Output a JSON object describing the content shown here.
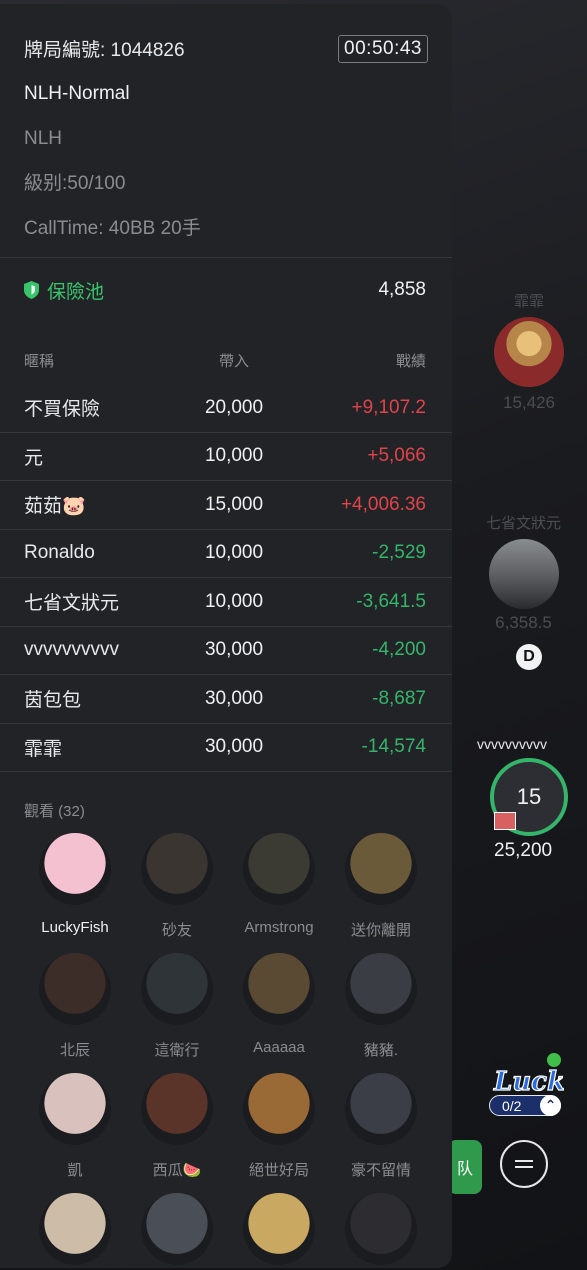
{
  "panel": {
    "hand_id": "牌局編號: 1044826",
    "timer": "00:50:43",
    "game_name": "NLH-Normal",
    "game_type": "NLH",
    "blinds": "級别:50/100",
    "calltime": "CallTime: 40BB 20手",
    "insurance_label": "保險池",
    "insurance_value": "4,858"
  },
  "table": {
    "headers": [
      "暱稱",
      "帶入",
      "戰績"
    ],
    "rows": [
      {
        "name": "不買保險",
        "buyin": "20,000",
        "result": "+9,107.2",
        "sign": "pos"
      },
      {
        "name": "元",
        "buyin": "10,000",
        "result": "+5,066",
        "sign": "pos"
      },
      {
        "name": "茹茹🐷",
        "buyin": "15,000",
        "result": "+4,006.36",
        "sign": "pos"
      },
      {
        "name": "Ronaldo",
        "buyin": "10,000",
        "result": "-2,529",
        "sign": "neg"
      },
      {
        "name": "七省文狀元",
        "buyin": "10,000",
        "result": "-3,641.5",
        "sign": "neg"
      },
      {
        "name": "vvvvvvvvvv",
        "buyin": "30,000",
        "result": "-4,200",
        "sign": "neg"
      },
      {
        "name": "茵包包",
        "buyin": "30,000",
        "result": "-8,687",
        "sign": "neg"
      },
      {
        "name": "霏霏",
        "buyin": "30,000",
        "result": "-14,574",
        "sign": "neg"
      }
    ]
  },
  "spectators": {
    "title": "觀看 (32)",
    "list": [
      {
        "name": "LuckyFish",
        "color": "#f3c1cf"
      },
      {
        "name": "砂友",
        "color": "#3a3530"
      },
      {
        "name": "Armstrong",
        "color": "#3b3a33"
      },
      {
        "name": "送你離開",
        "color": "#6a5a3a"
      },
      {
        "name": "北辰",
        "color": "#3c2d28"
      },
      {
        "name": "這衛行",
        "color": "#2f3438"
      },
      {
        "name": "Aaaaaa",
        "color": "#5a4a34"
      },
      {
        "name": "豬豬.",
        "color": "#3a3d44"
      },
      {
        "name": "凱",
        "color": "#d9c2bd"
      },
      {
        "name": "西瓜🍉",
        "color": "#5a3428"
      },
      {
        "name": "絕世好局",
        "color": "#9a6a36"
      },
      {
        "name": "豪不留情",
        "color": "#3b3e46"
      },
      {
        "name": "",
        "color": "#cdbca7"
      },
      {
        "name": "",
        "color": "#4a4e57"
      },
      {
        "name": "",
        "color": "#c9a862"
      },
      {
        "name": "",
        "color": "#2d2d31"
      }
    ]
  },
  "seats": {
    "s1_name": "霏霏",
    "s1_chips": "15,426",
    "s2_name": "七省文狀元",
    "s2_chips": "6,358.5",
    "dealer": "D",
    "hero_name": "vvvvvvvvvv",
    "hero_timer": "15",
    "hero_chips": "25,200",
    "lucky_text": "Lucky",
    "lucky_count": "0/2",
    "green_btn": "队"
  }
}
